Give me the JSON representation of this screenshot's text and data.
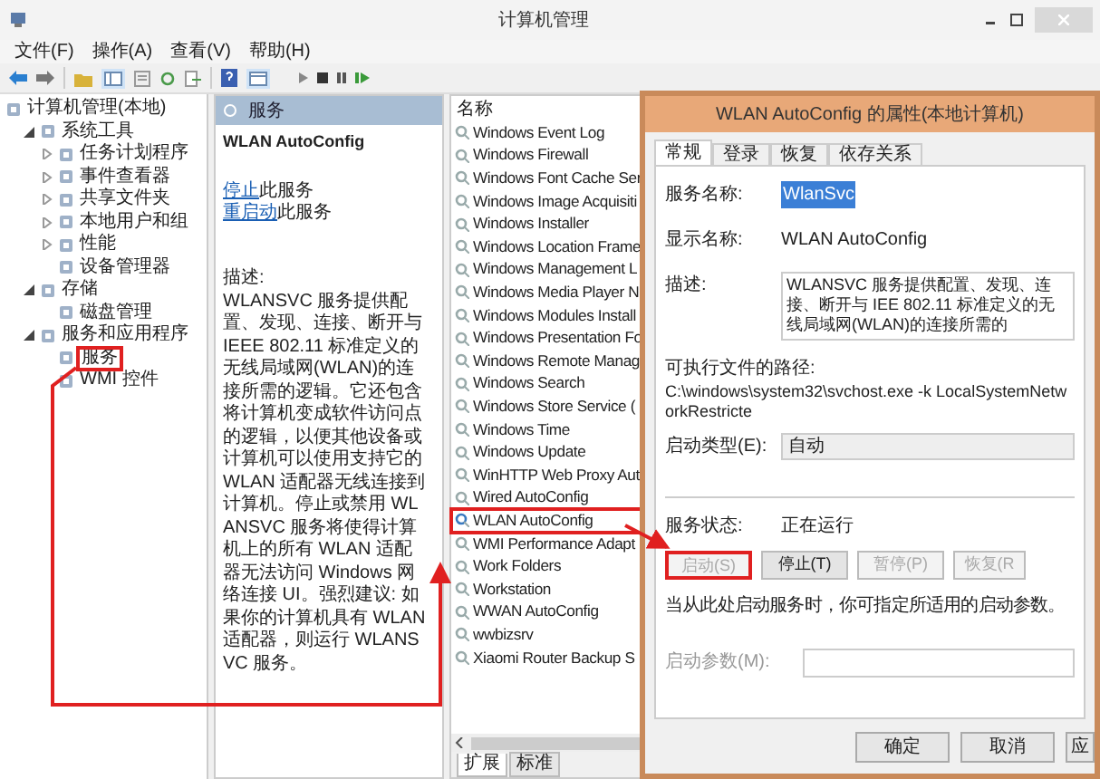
{
  "window": {
    "title": "计算机管理"
  },
  "menu": [
    "文件(F)",
    "操作(A)",
    "查看(V)",
    "帮助(H)"
  ],
  "tree": [
    {
      "label": "计算机管理(本地)",
      "children": [
        {
          "label": "系统工具",
          "expanded": true,
          "children": [
            {
              "label": "任务计划程序",
              "expanded": false
            },
            {
              "label": "事件查看器",
              "expanded": false
            },
            {
              "label": "共享文件夹",
              "expanded": false
            },
            {
              "label": "本地用户和组",
              "expanded": false
            },
            {
              "label": "性能",
              "expanded": false
            },
            {
              "label": "设备管理器"
            }
          ]
        },
        {
          "label": "存储",
          "expanded": true,
          "children": [
            {
              "label": "磁盘管理"
            }
          ]
        },
        {
          "label": "服务和应用程序",
          "expanded": true,
          "children": [
            {
              "label": "服务",
              "highlighted": true
            },
            {
              "label": "WMI 控件"
            }
          ]
        }
      ]
    }
  ],
  "panel": {
    "header": "服务",
    "service_name": "WLAN AutoConfig",
    "links": [
      {
        "link": "停止",
        "rest": "此服务"
      },
      {
        "link": "重启动",
        "rest": "此服务"
      }
    ],
    "description_label": "描述:",
    "description": "WLANSVC 服务提供配置、发现、连接、断开与 IEEE 802.11 标准定义的无线局域网(WLAN)的连接所需的逻辑。它还包含将计算机变成软件访问点的逻辑，以便其他设备或计算机可以使用支持它的 WLAN 适配器无线连接到计算机。停止或禁用 WLANSVC 服务将使得计算机上的所有 WLAN 适配器无法访问 Windows 网络连接 UI。强烈建议: 如果你的计算机具有 WLAN 适配器，则运行 WLANSVC 服务。"
  },
  "services": {
    "column": "名称",
    "rows": [
      {
        "name": "Windows Event Log",
        "highlighted": false
      },
      {
        "name": "Windows Firewall",
        "highlighted": false
      },
      {
        "name": "Windows Font Cache Ser",
        "highlighted": false
      },
      {
        "name": "Windows Image Acquisiti",
        "highlighted": false
      },
      {
        "name": "Windows Installer",
        "highlighted": false
      },
      {
        "name": "Windows Location Frame",
        "highlighted": false
      },
      {
        "name": "Windows Management L",
        "highlighted": false
      },
      {
        "name": "Windows Media Player N",
        "highlighted": false
      },
      {
        "name": "Windows Modules Install",
        "highlighted": false
      },
      {
        "name": "Windows Presentation Fo",
        "highlighted": false
      },
      {
        "name": "Windows Remote Manag",
        "highlighted": false
      },
      {
        "name": "Windows Search",
        "highlighted": false
      },
      {
        "name": "Windows Store Service (",
        "highlighted": false
      },
      {
        "name": "Windows Time",
        "highlighted": false
      },
      {
        "name": "Windows Update",
        "highlighted": false
      },
      {
        "name": "WinHTTP Web Proxy Aut",
        "highlighted": false
      },
      {
        "name": "Wired AutoConfig",
        "highlighted": false
      },
      {
        "name": "WLAN AutoConfig",
        "highlighted": true
      },
      {
        "name": "WMI Performance Adapt",
        "highlighted": false
      },
      {
        "name": "Work Folders",
        "highlighted": false
      },
      {
        "name": "Workstation",
        "highlighted": false
      },
      {
        "name": "WWAN AutoConfig",
        "highlighted": false
      },
      {
        "name": "wwbizsrv",
        "highlighted": false
      },
      {
        "name": "Xiaomi Router Backup S",
        "highlighted": false
      }
    ],
    "tabs": [
      {
        "label": "扩展",
        "selected": true
      },
      {
        "label": "标准",
        "selected": false
      }
    ]
  },
  "dialog": {
    "title": "WLAN AutoConfig 的属性(本地计算机)",
    "tabs": [
      {
        "label": "常规",
        "selected": true
      },
      {
        "label": "登录",
        "selected": false
      },
      {
        "label": "恢复",
        "selected": false
      },
      {
        "label": "依存关系",
        "selected": false
      }
    ],
    "service_name_label": "服务名称:",
    "service_name": "WlanSvc",
    "display_name_label": "显示名称:",
    "display_name": "WLAN AutoConfig",
    "description_label": "描述:",
    "description": "WLANSVC 服务提供配置、发现、连接、断开与 IEE 802.11 标准定义的无线局域网(WLAN)的连接所需的",
    "path_label": "可执行文件的路径:",
    "path": "C:\\windows\\system32\\svchost.exe -k LocalSystemNetworkRestricte",
    "startup_label": "启动类型(E):",
    "startup_value": "自动",
    "status_label": "服务状态:",
    "status_value": "正在运行",
    "control_buttons": [
      {
        "label": "启动(S)",
        "disabled": true,
        "highlighted": true
      },
      {
        "label": "停止(T)",
        "disabled": false,
        "highlighted": false
      },
      {
        "label": "暂停(P)",
        "disabled": true,
        "highlighted": false
      },
      {
        "label": "恢复(R",
        "disabled": true,
        "highlighted": false
      }
    ],
    "hint": "当从此处启动服务时，你可指定所适用的启动参数。",
    "params_label": "启动参数(M):",
    "footer_buttons": [
      "确定",
      "取消",
      "应"
    ]
  }
}
